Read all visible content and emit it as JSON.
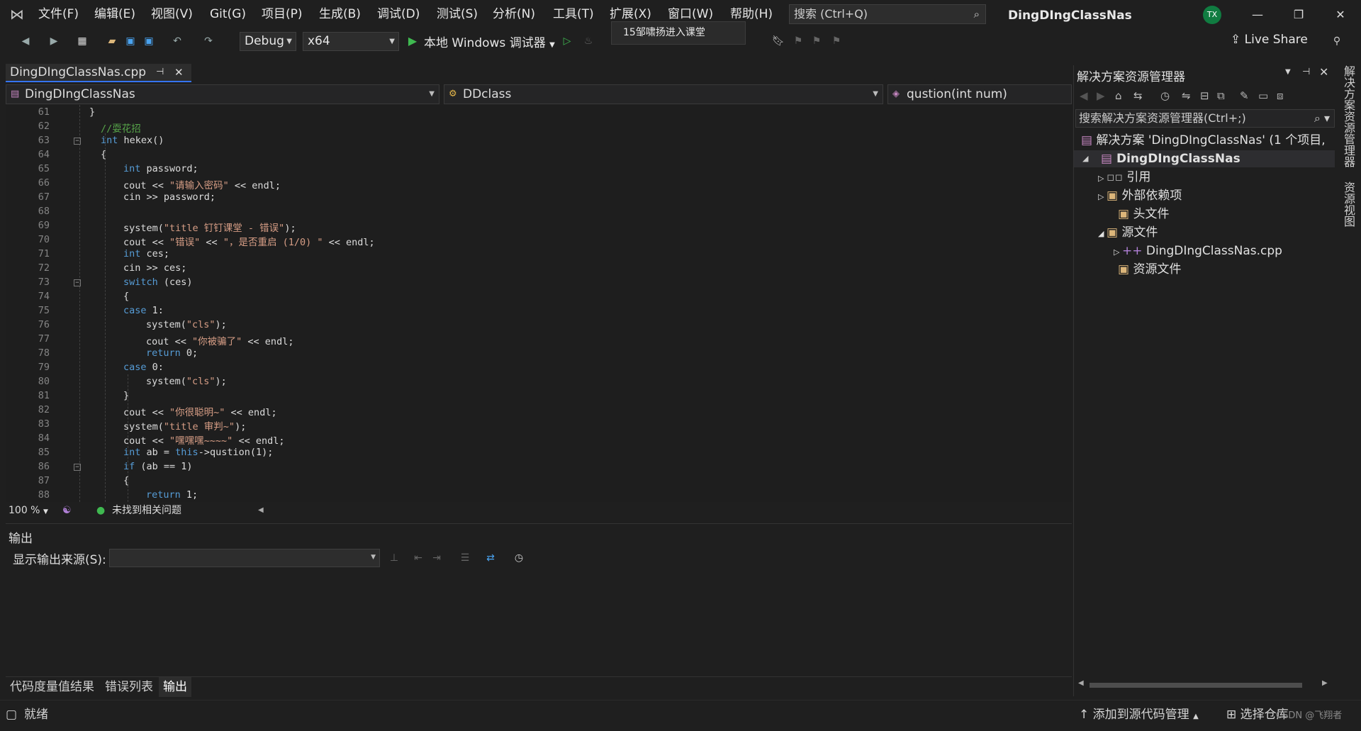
{
  "menu": [
    "文件(F)",
    "编辑(E)",
    "视图(V)",
    "Git(G)",
    "项目(P)",
    "生成(B)",
    "调试(D)",
    "测试(S)",
    "分析(N)",
    "工具(T)",
    "扩展(X)",
    "窗口(W)",
    "帮助(H)"
  ],
  "search_placeholder": "搜索 (Ctrl+Q)",
  "app_title": "DingDIngClassNas",
  "avatar": "TX",
  "toolbar": {
    "config": "Debug",
    "platform": "x64",
    "run_label": "本地 Windows 调试器",
    "live_share": "Live Share"
  },
  "tooltip": "15邹啸扬进入课堂",
  "doc_tab": "DingDIngClassNas.cpp",
  "nav": {
    "project": "DingDIngClassNas",
    "class": "DDclass",
    "member": "qustion(int num)"
  },
  "code_lines": [
    {
      "n": "61",
      "html": "}",
      "indent": 1
    },
    {
      "n": "62",
      "html": "<span class='cm'>//耍花招</span>",
      "indent": 1.5
    },
    {
      "n": "63",
      "html": "<span class='kw'>int</span> hekex()",
      "indent": 1.5
    },
    {
      "n": "64",
      "html": "{",
      "indent": 1.5
    },
    {
      "n": "65",
      "html": "<span class='kw'>int</span> password;",
      "indent": 2.5
    },
    {
      "n": "66",
      "html": "cout &lt;&lt; <span class='str'>\"请输入密码\"</span> &lt;&lt; endl;",
      "indent": 2.5
    },
    {
      "n": "67",
      "html": "cin &gt;&gt; password;",
      "indent": 2.5
    },
    {
      "n": "68",
      "html": "",
      "indent": 2.5
    },
    {
      "n": "69",
      "html": "system(<span class='str'>\"title 钉钉课堂 - 错误\"</span>);",
      "indent": 2.5
    },
    {
      "n": "70",
      "html": "cout &lt;&lt; <span class='str'>\"错误\"</span> &lt;&lt; <span class='str'>\"，是否重启 (1/0) \"</span> &lt;&lt; endl;",
      "indent": 2.5
    },
    {
      "n": "71",
      "html": "<span class='kw'>int</span> ces;",
      "indent": 2.5
    },
    {
      "n": "72",
      "html": "cin &gt;&gt; ces;",
      "indent": 2.5
    },
    {
      "n": "73",
      "html": "<span class='kw'>switch</span> (ces)",
      "indent": 2.5
    },
    {
      "n": "74",
      "html": "{",
      "indent": 2.5
    },
    {
      "n": "75",
      "html": "<span class='kw'>case</span> 1:",
      "indent": 2.5
    },
    {
      "n": "76",
      "html": "system(<span class='str'>\"cls\"</span>);",
      "indent": 3.5
    },
    {
      "n": "77",
      "html": "cout &lt;&lt; <span class='str'>\"你被骗了\"</span> &lt;&lt; endl;",
      "indent": 3.5
    },
    {
      "n": "78",
      "html": "<span class='kw'>return</span> 0;",
      "indent": 3.5
    },
    {
      "n": "79",
      "html": "<span class='kw'>case</span> 0:",
      "indent": 2.5
    },
    {
      "n": "80",
      "html": "system(<span class='str'>\"cls\"</span>);",
      "indent": 3.5
    },
    {
      "n": "81",
      "html": "}",
      "indent": 2.5
    },
    {
      "n": "82",
      "html": "cout &lt;&lt; <span class='str'>\"你很聪明~\"</span> &lt;&lt; endl;",
      "indent": 2.5
    },
    {
      "n": "83",
      "html": "system(<span class='str'>\"title 审判~\"</span>);",
      "indent": 2.5
    },
    {
      "n": "84",
      "html": "cout &lt;&lt; <span class='str'>\"嘿嘿嘿~~~~\"</span> &lt;&lt; endl;",
      "indent": 2.5
    },
    {
      "n": "85",
      "html": "<span class='kw'>int</span> ab = <span class='kw'>this</span>-&gt;qustion(1);",
      "indent": 2.5
    },
    {
      "n": "86",
      "html": "<span class='kw'>if</span> (ab == 1)",
      "indent": 2.5
    },
    {
      "n": "87",
      "html": "{",
      "indent": 2.5
    },
    {
      "n": "88",
      "html": "<span class='kw'>return</span> 1;",
      "indent": 3.5
    }
  ],
  "fold_lines": [
    "63",
    "73",
    "86"
  ],
  "zoom": "100 %",
  "issues": "未找到相关问题",
  "output": {
    "title": "输出",
    "source_label": "显示输出来源(S):"
  },
  "bottom_tabs": [
    "代码度量值结果",
    "错误列表",
    "输出"
  ],
  "explorer": {
    "title": "解决方案资源管理器",
    "search": "搜索解决方案资源管理器(Ctrl+;)",
    "solution": "解决方案 'DingDIngClassNas' (1 个项目,",
    "project": "DingDIngClassNas",
    "items": [
      "引用",
      "外部依赖项",
      "头文件",
      "源文件",
      "DingDIngClassNas.cpp",
      "资源文件"
    ]
  },
  "vtabs": [
    "解决方案资源管理器",
    "资源视图"
  ],
  "status": {
    "ready": "就绪",
    "add_source": "添加到源代码管理",
    "select_repo": "选择仓库",
    "watermark": "CSDN @飞翔者"
  },
  "colors": {
    "accent": "#3574f0",
    "keyword": "#569cd6",
    "string": "#d69d85",
    "comment": "#57a64a"
  }
}
